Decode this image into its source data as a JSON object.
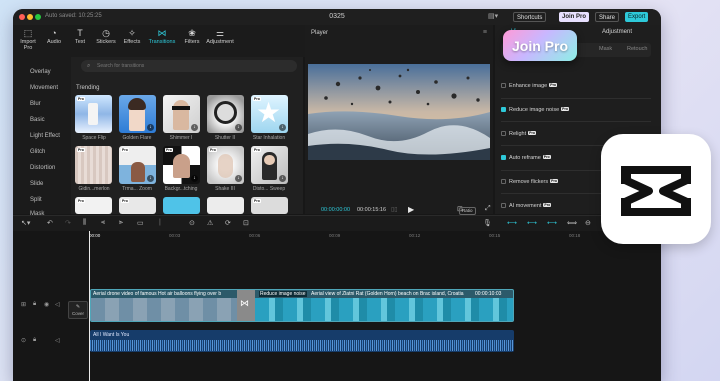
{
  "titlebar": {
    "autosave": "Auto saved: 10:25:25",
    "project_name": "0325",
    "shortcuts_label": "Shortcuts",
    "join_pro_label": "Join Pro",
    "share_label": "Share",
    "export_label": "Export"
  },
  "toolbar": {
    "items": [
      {
        "label": "Import",
        "sub": "Pro",
        "icon": "import-icon"
      },
      {
        "label": "Audio",
        "icon": "audio-icon"
      },
      {
        "label": "Text",
        "icon": "text-icon"
      },
      {
        "label": "Stickers",
        "icon": "stickers-icon"
      },
      {
        "label": "Effects",
        "icon": "effects-icon"
      },
      {
        "label": "Transitions",
        "icon": "transitions-icon",
        "active": true
      },
      {
        "label": "Filters",
        "icon": "filters-icon"
      },
      {
        "label": "Adjustment",
        "icon": "adjustment-icon"
      }
    ]
  },
  "sidebar": {
    "items": [
      "Overlay",
      "Movement",
      "Blur",
      "Basic",
      "Light Effect",
      "Glitch",
      "Distortion",
      "Slide",
      "Split",
      "Mask"
    ]
  },
  "media": {
    "search_placeholder": "Search for transitions",
    "trending_label": "Trending",
    "thumbs": [
      {
        "label": "Space Flip"
      },
      {
        "label": "Golden Flare"
      },
      {
        "label": "Shimmer I"
      },
      {
        "label": "Shutter II"
      },
      {
        "label": "Star Inhalation"
      },
      {
        "label": "Gidin...merlon"
      },
      {
        "label": "Trma... Zoom"
      },
      {
        "label": "Backgr...tching"
      },
      {
        "label": "Shake III"
      },
      {
        "label": "Disto... Sweep"
      }
    ]
  },
  "player": {
    "title": "Player",
    "time_current": "00:00:00:00",
    "time_total": "00:00:15:16",
    "ratio_label": "Ratio"
  },
  "props": {
    "tab_video": "Vi",
    "tab_adjustment": "Adjustment",
    "subtab_mask": "Mask",
    "subtab_retouch": "Retouch",
    "options": [
      {
        "label": "Enhance image",
        "checked": false
      },
      {
        "label": "Reduce image noise",
        "checked": true
      },
      {
        "label": "Relight",
        "checked": false
      },
      {
        "label": "Auto reframe",
        "checked": true
      },
      {
        "label": "Remove flickers",
        "checked": false
      },
      {
        "label": "AI movement",
        "checked": false
      }
    ],
    "pro_badge": "Pro"
  },
  "join_tooltip": "Join Pro",
  "timeline": {
    "ruler": [
      "00:00",
      "00:03",
      "00:06",
      "00:09",
      "00:12",
      "00:15",
      "00:18"
    ],
    "cover_label": "Cover",
    "video_clip_1": "Aerial drone video of famous Hot air balloons flying over b",
    "video_clip_2_badge": "Reduce image noise",
    "video_clip_2": "Aerial view of Zlatni Rat (Golden Horn) beach on Brac island, Croatia",
    "video_clip_2_time": "00:00:10:03",
    "audio_clip": "All I Want Is You"
  },
  "colors": {
    "accent": "#2ec9d9",
    "window_bg": "#171717",
    "clip_video": "#2c5a6a",
    "clip_audio": "#163c6a"
  }
}
